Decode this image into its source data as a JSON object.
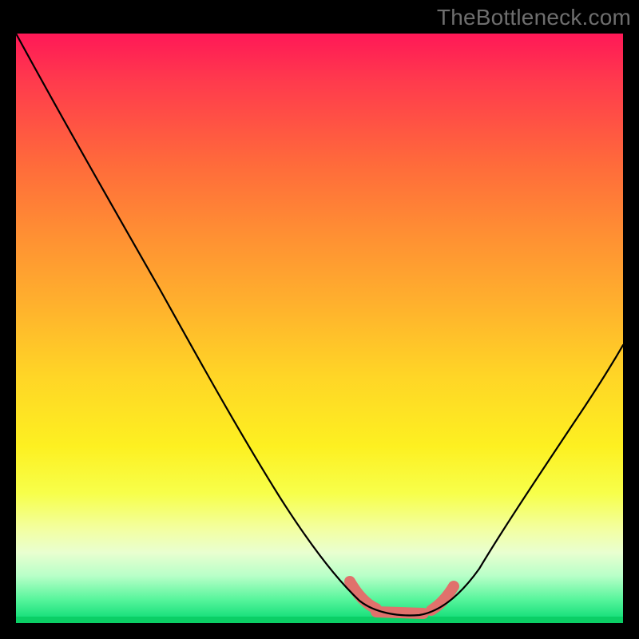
{
  "watermark": "TheBottleneck.com",
  "chart_data": {
    "type": "line",
    "title": "",
    "xlabel": "",
    "ylabel": "",
    "series": [
      {
        "name": "curve",
        "x": [
          0.0,
          0.05,
          0.1,
          0.15,
          0.2,
          0.25,
          0.3,
          0.35,
          0.4,
          0.45,
          0.5,
          0.55,
          0.6,
          0.63,
          0.65,
          0.7,
          0.75,
          0.8,
          0.85,
          0.9,
          0.95,
          1.0
        ],
        "y": [
          1.0,
          0.92,
          0.84,
          0.76,
          0.67,
          0.58,
          0.49,
          0.4,
          0.31,
          0.22,
          0.13,
          0.06,
          0.02,
          0.01,
          0.01,
          0.02,
          0.05,
          0.11,
          0.21,
          0.33,
          0.46,
          0.58
        ]
      }
    ],
    "highlight_range_x": [
      0.55,
      0.72
    ],
    "xlim": [
      0,
      1
    ],
    "ylim": [
      0,
      1
    ],
    "legend": false,
    "grid": false
  },
  "colors": {
    "background": "#000000",
    "watermark": "#6e6e6e",
    "curve": "#000000",
    "highlight": "#e0716c",
    "gradient_top": "#ff1857",
    "gradient_bottom": "#0fd66e"
  }
}
